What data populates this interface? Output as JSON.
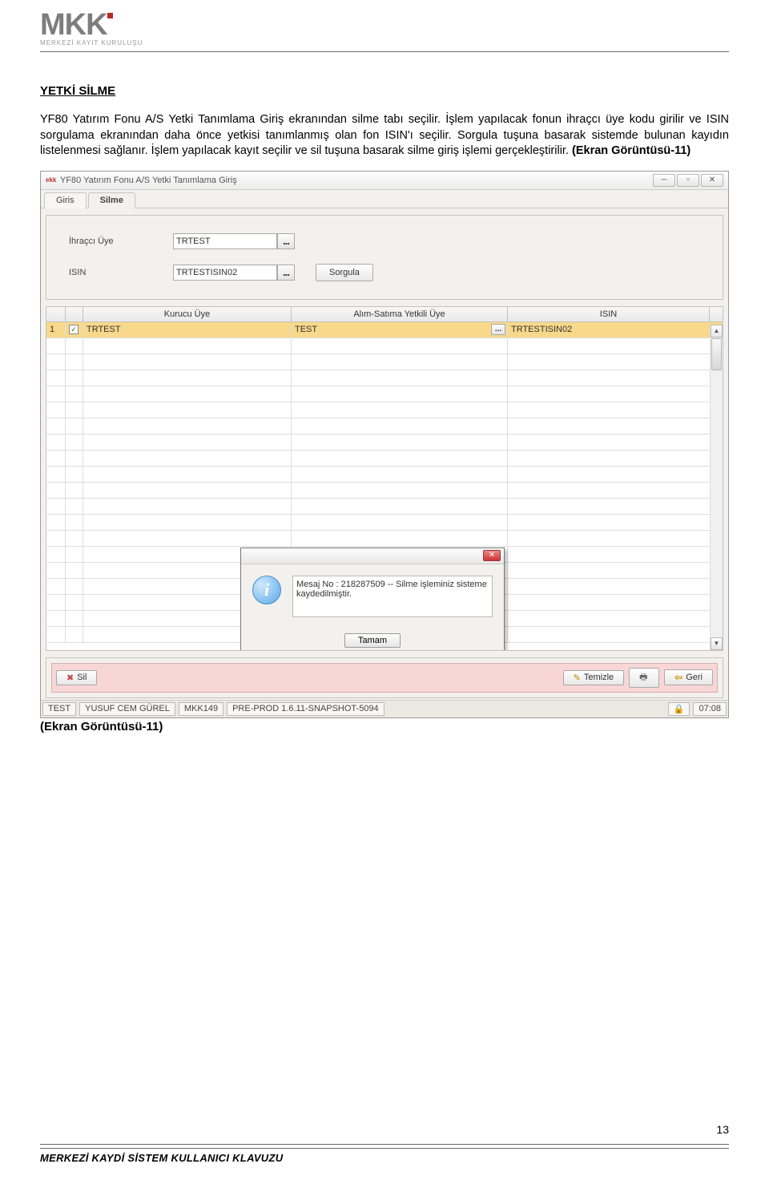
{
  "logo": {
    "text": "MKK",
    "subtitle": "MERKEZİ KAYIT KURULUŞU"
  },
  "doc": {
    "heading": "YETKİ SİLME",
    "para1": "YF80 Yatırım Fonu A/S Yetki Tanımlama Giriş ekranından silme tabı seçilir. İşlem yapılacak fonun ihraçcı üye kodu girilir ve ISIN sorgulama ekranından daha önce yetkisi tanımlanmış olan fon ISIN'ı seçilir. Sorgula tuşuna basarak sistemde bulunan kayıdın listelenmesi sağlanır. İşlem yapılacak kayıt seçilir ve sil tuşuna basarak silme giriş işlemi gerçekleştirilir. ",
    "para1_bold": "(Ekran Görüntüsü-11)"
  },
  "window": {
    "title": "YF80 Yatırım Fonu A/S Yetki Tanımlama Giriş",
    "tabs": {
      "giris": "Giris",
      "silme": "Silme"
    },
    "form": {
      "label_ihracci": "İhraçcı Üye",
      "value_ihracci": "TRTEST",
      "label_isin": "ISIN",
      "value_isin": "TRTESTISIN02",
      "btn_sorgula": "Sorgula",
      "picker": "..."
    },
    "grid": {
      "col_kurucu": "Kurucu Üye",
      "col_yetkili": "Alım-Satıma Yetkili Üye",
      "col_isin": "ISIN",
      "row1": {
        "idx": "1",
        "kurucu": "TRTEST",
        "yetkili": "TEST",
        "isin": "TRTESTISIN02"
      }
    },
    "dialog": {
      "msg": "Mesaj No : 218287509 -- Silme işleminiz sisteme kaydedilmiştir.",
      "ok": "Tamam",
      "close": "✕"
    },
    "actions": {
      "sil": "Sil",
      "temizle": "Temizle",
      "geri": "Geri"
    },
    "status": {
      "s1": "TEST",
      "s2": "YUSUF CEM GÜREL",
      "s3": "MKK149",
      "s4": "PRE-PROD 1.6.11-SNAPSHOT-5094",
      "time": "07:08"
    }
  },
  "caption": "(Ekran Görüntüsü-11)",
  "footer": {
    "page": "13",
    "label": "MERKEZİ KAYDİ SİSTEM KULLANICI KLAVUZU"
  }
}
